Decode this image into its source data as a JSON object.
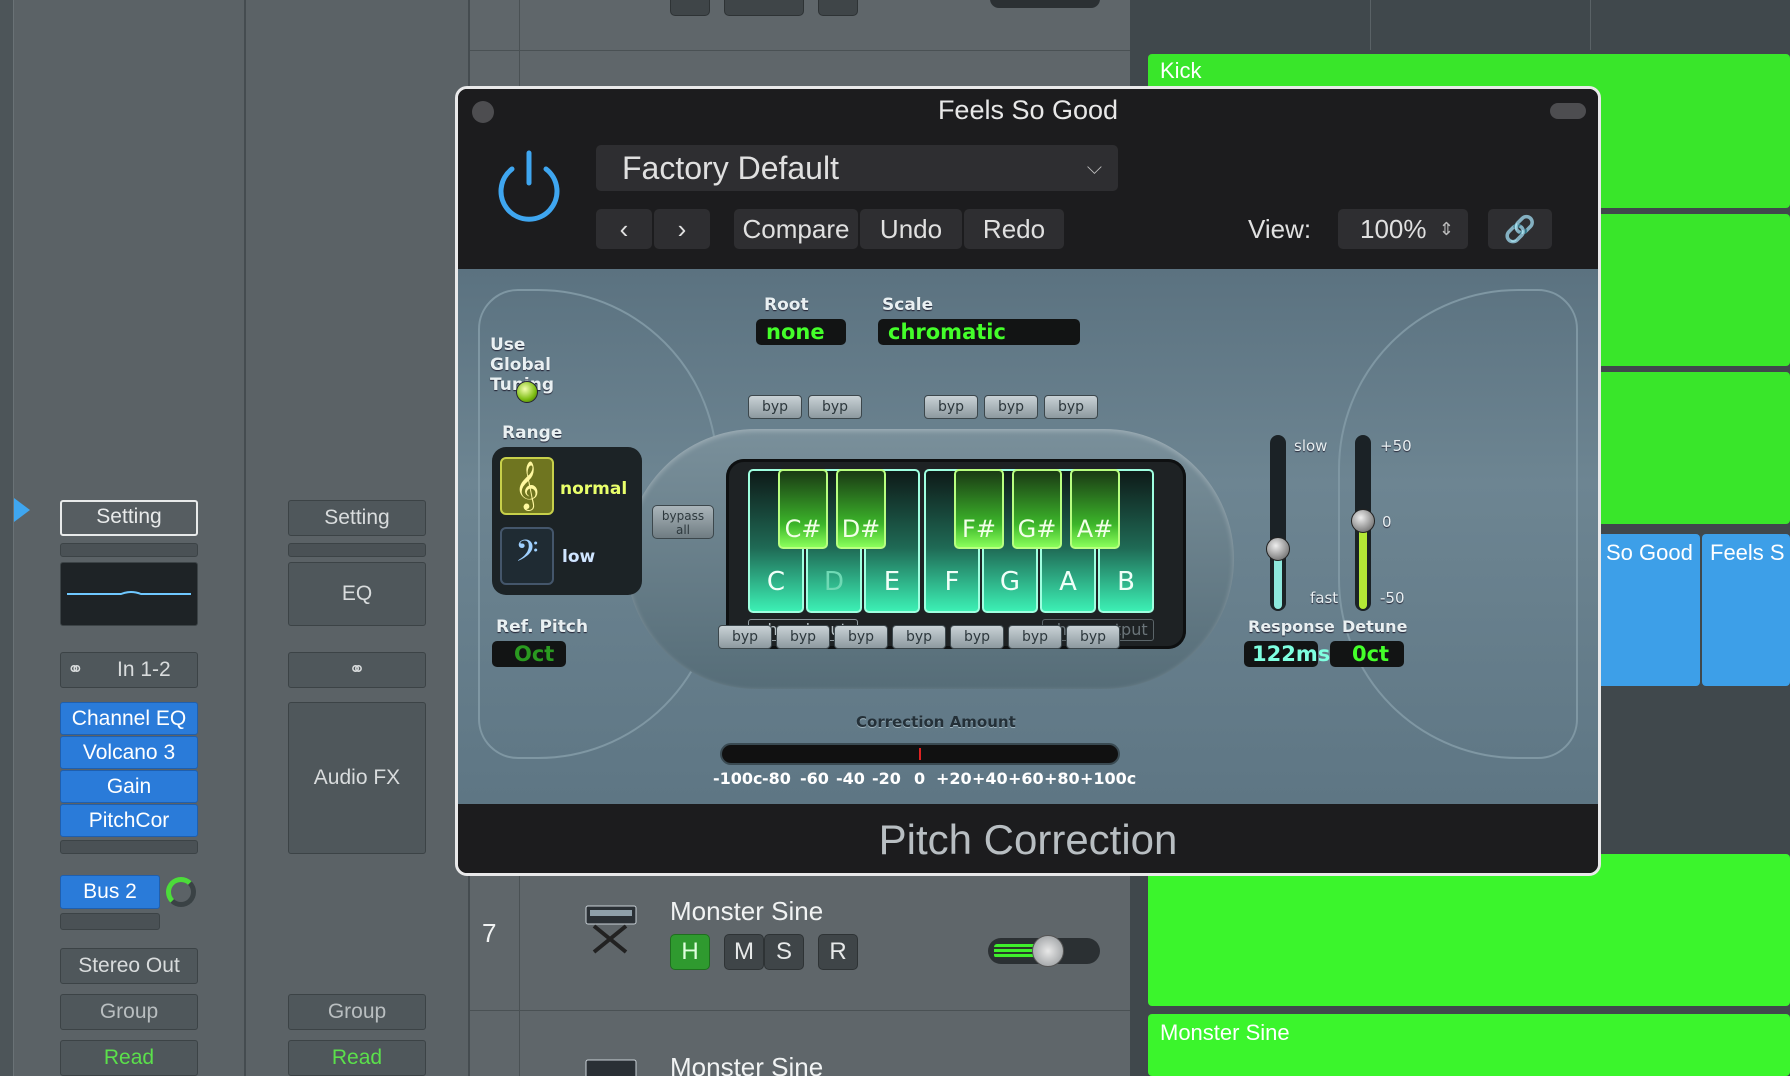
{
  "mixer": {
    "strip1": {
      "setting": "Setting",
      "input": "In 1-2",
      "plugins": [
        "Channel EQ",
        "Volcano 3",
        "Gain",
        "PitchCor"
      ],
      "send": "Bus 2",
      "output": "Stereo Out",
      "group": "Group",
      "automation": "Read"
    },
    "strip2": {
      "setting": "Setting",
      "eq": "EQ",
      "audio_fx": "Audio FX",
      "group": "Group",
      "automation": "Read"
    }
  },
  "tracks": [
    {
      "number": "7",
      "name": "Monster Sine",
      "buttons": [
        "H",
        "M",
        "S",
        "R"
      ]
    },
    {
      "number": "",
      "name": "Monster Sine"
    }
  ],
  "arrange": {
    "regions": [
      "Kick",
      "So Good",
      "Feels S",
      "Monster Sine"
    ]
  },
  "plugin": {
    "window_title": "Feels So Good",
    "preset": "Factory Default",
    "compare": "Compare",
    "undo": "Undo",
    "redo": "Redo",
    "view_label": "View:",
    "view_value": "100%",
    "footer": "Pitch Correction",
    "root_label": "Root",
    "root_value": "none",
    "scale_label": "Scale",
    "scale_value": "chromatic",
    "use_global_tuning": "Use Global Tuning",
    "range_label": "Range",
    "range_normal": "normal",
    "range_low": "low",
    "ref_pitch_label": "Ref. Pitch",
    "ref_pitch_value": "Oct",
    "bypass_all": "bypass all",
    "byp": "byp",
    "white_keys": [
      "C",
      "D",
      "E",
      "F",
      "G",
      "A",
      "B"
    ],
    "black_keys": [
      "C#",
      "D#",
      "F#",
      "G#",
      "A#"
    ],
    "show_input": "show input",
    "show_output": "show output",
    "correction_amount": "Correction Amount",
    "correction_scale": [
      "-100c",
      "-80",
      "-60",
      "-40",
      "-20",
      "0",
      "+20",
      "+40",
      "+60",
      "+80",
      "+100c"
    ],
    "response_label": "Response",
    "response_value": "122ms",
    "response_slow": "slow",
    "response_fast": "fast",
    "detune_label": "Detune",
    "detune_value": "0ct",
    "detune_plus": "+50",
    "detune_zero": "0",
    "detune_minus": "-50"
  },
  "colors": {
    "lcd_green": "#44ff2a",
    "region_green": "#39e62a",
    "blue_slot": "#2a7bd9",
    "power_blue": "#3fa6f0"
  }
}
